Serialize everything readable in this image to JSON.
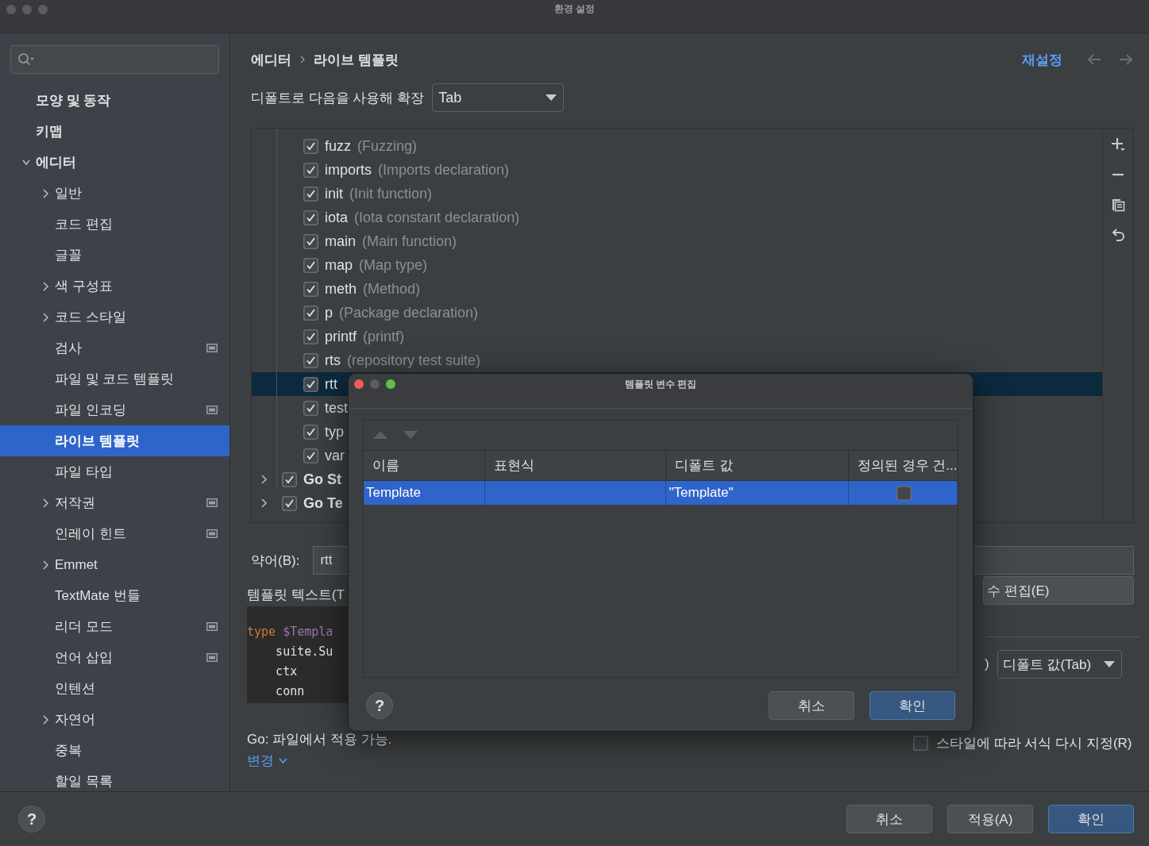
{
  "window": {
    "title": "환경 설정"
  },
  "sidebar": {
    "items": [
      {
        "label": "모양 및 동작",
        "kind": "page",
        "selected": false,
        "scoped": false
      },
      {
        "label": "키맵",
        "kind": "page",
        "selected": false,
        "scoped": false
      },
      {
        "label": "에디터",
        "kind": "group",
        "expanded": true,
        "selected": false,
        "scoped": false,
        "children": [
          {
            "label": "일반",
            "kind": "group",
            "expanded": false,
            "selected": false,
            "scoped": false
          },
          {
            "label": "코드 편집",
            "kind": "page",
            "selected": false,
            "scoped": false
          },
          {
            "label": "글꼴",
            "kind": "page",
            "selected": false,
            "scoped": false
          },
          {
            "label": "색 구성표",
            "kind": "group",
            "expanded": false,
            "selected": false,
            "scoped": false
          },
          {
            "label": "코드 스타일",
            "kind": "group",
            "expanded": false,
            "selected": false,
            "scoped": false
          },
          {
            "label": "검사",
            "kind": "page",
            "selected": false,
            "scoped": true
          },
          {
            "label": "파일 및 코드 템플릿",
            "kind": "page",
            "selected": false,
            "scoped": false
          },
          {
            "label": "파일 인코딩",
            "kind": "page",
            "selected": false,
            "scoped": true
          },
          {
            "label": "라이브 템플릿",
            "kind": "page",
            "selected": true,
            "scoped": false
          },
          {
            "label": "파일 타입",
            "kind": "page",
            "selected": false,
            "scoped": false
          },
          {
            "label": "저작권",
            "kind": "group",
            "expanded": false,
            "selected": false,
            "scoped": true
          },
          {
            "label": "인레이 힌트",
            "kind": "page",
            "selected": false,
            "scoped": true
          },
          {
            "label": "Emmet",
            "kind": "group",
            "expanded": false,
            "selected": false,
            "scoped": false
          },
          {
            "label": "TextMate 번들",
            "kind": "page",
            "selected": false,
            "scoped": false
          },
          {
            "label": "리더 모드",
            "kind": "page",
            "selected": false,
            "scoped": true
          },
          {
            "label": "언어 삽입",
            "kind": "page",
            "selected": false,
            "scoped": true
          },
          {
            "label": "인텐션",
            "kind": "page",
            "selected": false,
            "scoped": false
          },
          {
            "label": "자연어",
            "kind": "group",
            "expanded": false,
            "selected": false,
            "scoped": false
          },
          {
            "label": "중복",
            "kind": "page",
            "selected": false,
            "scoped": false
          },
          {
            "label": "할일 목록",
            "kind": "page",
            "selected": false,
            "scoped": false
          }
        ]
      }
    ]
  },
  "breadcrumb": [
    "에디터",
    "라이브 템플릿"
  ],
  "reset_link": "재설정",
  "expand_with": {
    "label": "디폴트로 다음을 사용해 확장",
    "value": "Tab"
  },
  "templates": {
    "rows": [
      {
        "kind": "item",
        "abbreviation": "fuzz",
        "description": "(Fuzzing)",
        "checked": true,
        "selected": false
      },
      {
        "kind": "item",
        "abbreviation": "imports",
        "description": "(Imports declaration)",
        "checked": true,
        "selected": false
      },
      {
        "kind": "item",
        "abbreviation": "init",
        "description": "(Init function)",
        "checked": true,
        "selected": false
      },
      {
        "kind": "item",
        "abbreviation": "iota",
        "description": "(Iota constant declaration)",
        "checked": true,
        "selected": false
      },
      {
        "kind": "item",
        "abbreviation": "main",
        "description": "(Main function)",
        "checked": true,
        "selected": false
      },
      {
        "kind": "item",
        "abbreviation": "map",
        "description": "(Map type)",
        "checked": true,
        "selected": false
      },
      {
        "kind": "item",
        "abbreviation": "meth",
        "description": "(Method)",
        "checked": true,
        "selected": false
      },
      {
        "kind": "item",
        "abbreviation": "p",
        "description": "(Package declaration)",
        "checked": true,
        "selected": false
      },
      {
        "kind": "item",
        "abbreviation": "printf",
        "description": "(printf)",
        "checked": true,
        "selected": false
      },
      {
        "kind": "item",
        "abbreviation": "rts",
        "description": "(repository test suite)",
        "checked": true,
        "selected": false
      },
      {
        "kind": "item",
        "abbreviation": "rtt",
        "checked": true,
        "selected": true
      },
      {
        "kind": "item",
        "abbreviation": "test",
        "checked": true,
        "selected": false
      },
      {
        "kind": "item",
        "abbreviation": "typ",
        "checked": true,
        "selected": false
      },
      {
        "kind": "item",
        "abbreviation": "var",
        "checked": true,
        "selected": false
      },
      {
        "kind": "group",
        "abbreviation": "Go St",
        "checked": true,
        "expanded": false,
        "selected": false
      },
      {
        "kind": "group",
        "abbreviation": "Go Te",
        "checked": true,
        "expanded": false,
        "selected": false
      }
    ]
  },
  "abbreviation": {
    "label": "약어(B):",
    "value": "rtt"
  },
  "template_text": {
    "label": "템플릿 텍스트(T",
    "lines": [
      {
        "tokens": [
          {
            "kind": "keyword",
            "text": "type "
          },
          {
            "kind": "variable",
            "text": "$Templa"
          }
        ]
      },
      {
        "tokens": [
          {
            "kind": "plain",
            "text": "    suite.Su"
          }
        ]
      },
      {
        "tokens": [
          {
            "kind": "plain",
            "text": "    ctx"
          }
        ]
      },
      {
        "tokens": [
          {
            "kind": "plain",
            "text": "    conn"
          }
        ]
      }
    ]
  },
  "applicability": "Go: 파일에서 적용 가능.",
  "change_link": "변경",
  "edit_variables_button": "수 편집(E)",
  "expand_option": {
    "label": ")",
    "value": "디폴트 값(Tab)"
  },
  "reformat": {
    "label": "스타일에 따라 서식 다시 지정(R)",
    "checked": false
  },
  "help_button": "?",
  "footer_buttons": [
    {
      "label": "취소",
      "primary": false
    },
    {
      "label": "적용(A)",
      "primary": false
    },
    {
      "label": "확인",
      "primary": true
    }
  ],
  "dialog": {
    "title": "템플릿 변수 편집",
    "columns": [
      "이름",
      "표현식",
      "디폴트 값",
      "정의된 경우 건..."
    ],
    "rows": [
      {
        "name": "Template",
        "default_value": "\"Template\"",
        "skip_if_defined": false,
        "selected": true
      }
    ],
    "help_button": "?",
    "buttons": [
      {
        "label": "취소",
        "primary": false
      },
      {
        "label": "확인",
        "primary": true
      }
    ]
  }
}
